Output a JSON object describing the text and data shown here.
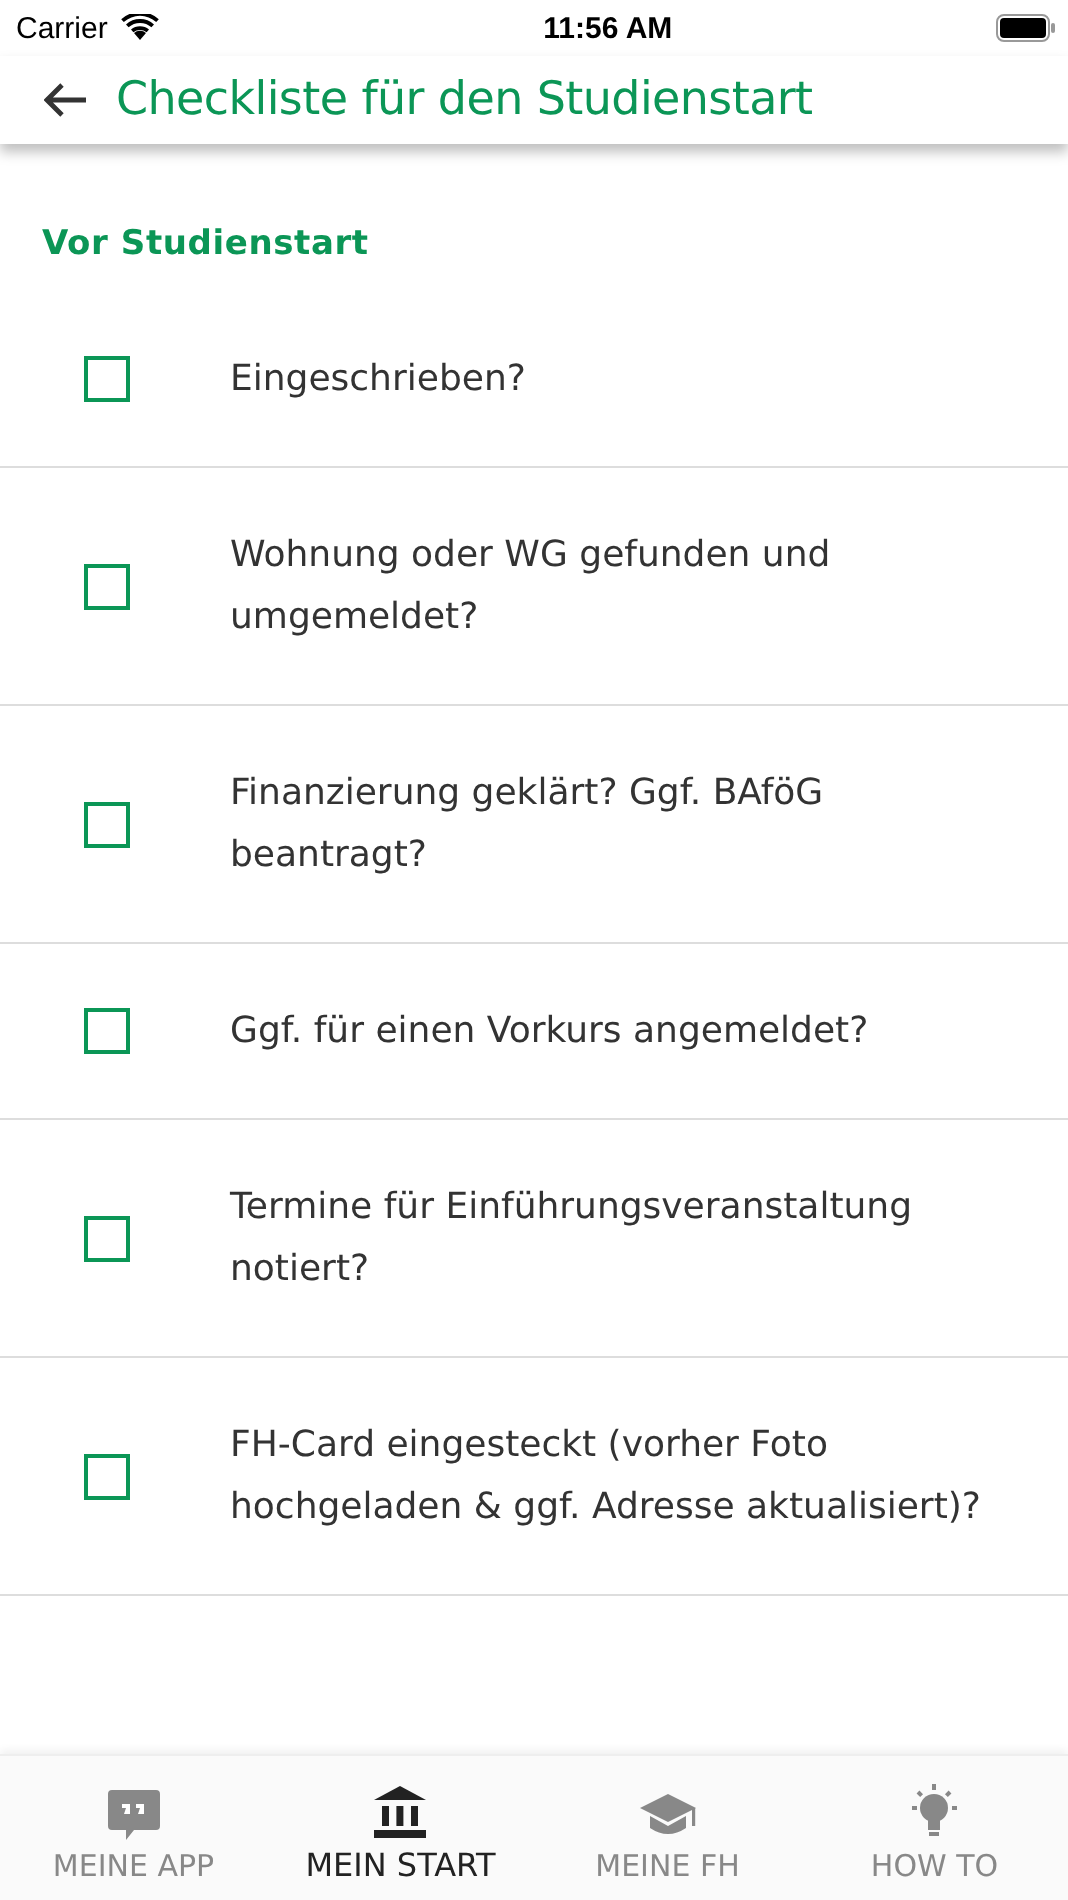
{
  "status_bar": {
    "carrier": "Carrier",
    "time": "11:56 AM"
  },
  "header": {
    "title": "Checkliste für den Studienstart"
  },
  "section": {
    "title": "Vor Studienstart"
  },
  "items": [
    {
      "label": "Eingeschrieben?",
      "checked": false
    },
    {
      "label": "Wohnung oder WG gefunden und umgemeldet?",
      "checked": false
    },
    {
      "label": "Finanzierung geklärt? Ggf. BAföG beantragt?",
      "checked": false
    },
    {
      "label": "Ggf. für einen Vorkurs angemeldet?",
      "checked": false
    },
    {
      "label": "Termine für Einführungsveranstaltung notiert?",
      "checked": false
    },
    {
      "label": "FH-Card eingesteckt (vorher Foto hochgeladen & ggf. Adresse aktualisiert)?",
      "checked": false
    }
  ],
  "tabs": [
    {
      "label": "MEINE APP",
      "kind": "quote",
      "selected": false
    },
    {
      "label": "MEIN START",
      "kind": "building",
      "selected": true
    },
    {
      "label": "MEINE FH",
      "kind": "cap",
      "selected": false
    },
    {
      "label": "HOW TO",
      "kind": "bulb",
      "selected": false
    }
  ]
}
